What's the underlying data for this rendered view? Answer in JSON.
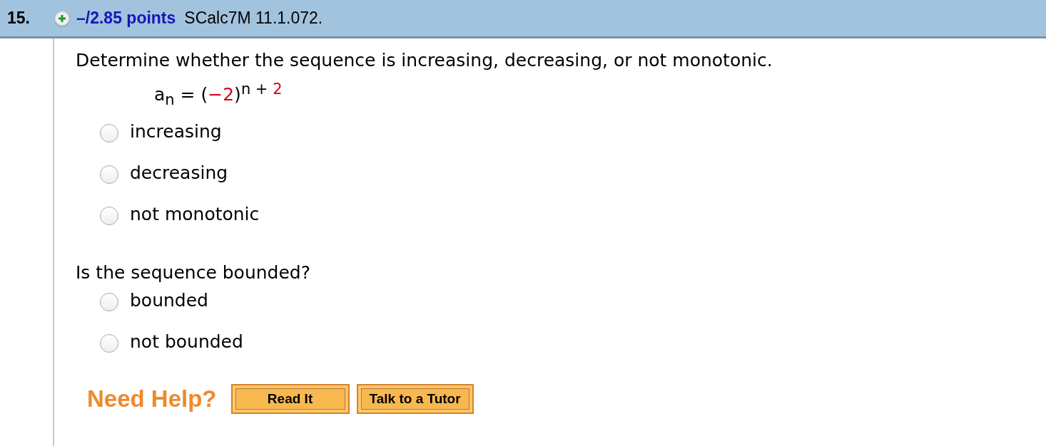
{
  "header": {
    "number": "15.",
    "points": "–/2.85 points",
    "code": "SCalc7M 11.1.072."
  },
  "question": "Determine whether the sequence is increasing, decreasing, or not monotonic.",
  "formula": [
    {
      "text": "a",
      "kind": "normal",
      "color": "#000000"
    },
    {
      "text": "n",
      "kind": "sub",
      "color": "#000000"
    },
    {
      "text": " = (",
      "kind": "normal",
      "color": "#000000"
    },
    {
      "text": "−2",
      "kind": "normal",
      "color": "#d0021b"
    },
    {
      "text": ")",
      "kind": "normal",
      "color": "#000000"
    },
    {
      "text": "n",
      "kind": "sup",
      "color": "#000000"
    },
    {
      "text": " + ",
      "kind": "sup",
      "color": "#000000"
    },
    {
      "text": "2",
      "kind": "sup",
      "color": "#d0021b"
    }
  ],
  "options1": [
    {
      "label": "increasing",
      "selected": false
    },
    {
      "label": "decreasing",
      "selected": false
    },
    {
      "label": "not monotonic",
      "selected": false
    }
  ],
  "question2": "Is the sequence bounded?",
  "options2": [
    {
      "label": "bounded",
      "selected": false
    },
    {
      "label": "not bounded",
      "selected": false
    }
  ],
  "help": {
    "label": "Need Help?",
    "buttons": [
      "Read It",
      "Talk to a Tutor"
    ]
  }
}
